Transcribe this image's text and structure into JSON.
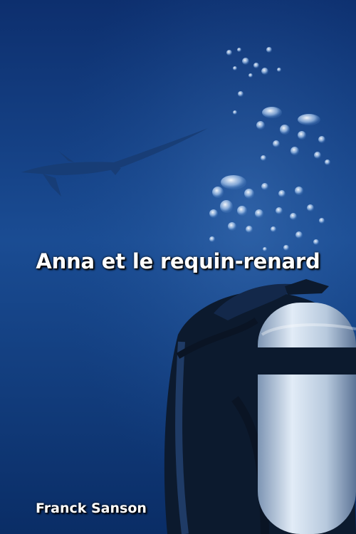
{
  "cover": {
    "title": "Anna et le requin-renard",
    "author": "Franck Sanson"
  },
  "scene": {
    "subject": "scuba-diver-with-thresher-shark",
    "colors": {
      "water_top": "#0d2f6e",
      "water_mid": "#1a4c93",
      "water_bottom": "#0a2d66",
      "bubble": "#bcd6f3",
      "tank": "#d9e6f3",
      "diver": "#0c1a2e"
    }
  }
}
